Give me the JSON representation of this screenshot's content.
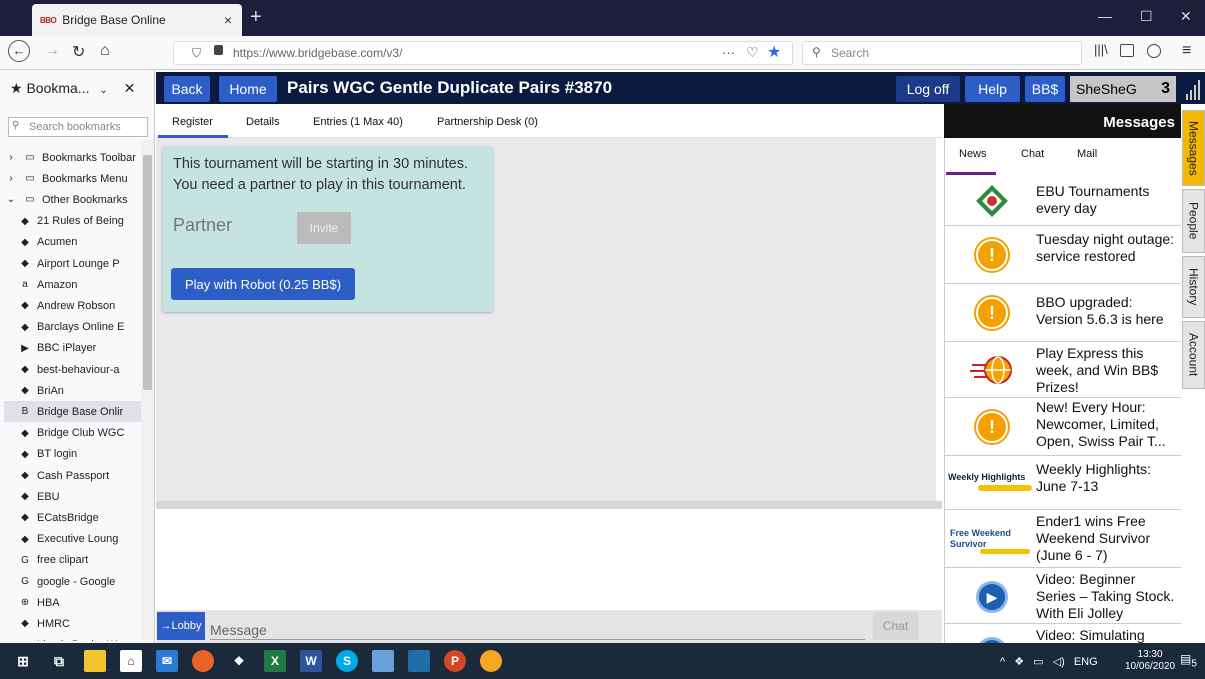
{
  "browser": {
    "tab_title": "Bridge Base Online",
    "tab_favicon_text": "BBO",
    "url": "https://www.bridgebase.com/v3/",
    "search_placeholder": "Search",
    "url_actions": "···"
  },
  "sidebar": {
    "header": "Bookma...",
    "search_placeholder": "Search bookmarks",
    "items": [
      {
        "label": "Bookmarks Toolbar",
        "icon": "folder-icon"
      },
      {
        "label": "Bookmarks Menu",
        "icon": "folder-icon"
      },
      {
        "label": "Other Bookmarks",
        "icon": "folder-icon"
      },
      {
        "label": "21 Rules of Being",
        "icon": "page-icon"
      },
      {
        "label": "Acumen",
        "icon": "page-icon"
      },
      {
        "label": "Airport Lounge P",
        "icon": "page-icon"
      },
      {
        "label": "Amazon",
        "icon": "amazon-icon"
      },
      {
        "label": "Andrew Robson",
        "icon": "page-icon"
      },
      {
        "label": "Barclays Online E",
        "icon": "page-icon"
      },
      {
        "label": "BBC iPlayer",
        "icon": "play-icon"
      },
      {
        "label": "best-behaviour-a",
        "icon": "page-icon"
      },
      {
        "label": "BriAn",
        "icon": "page-icon"
      },
      {
        "label": "Bridge Base Onlir",
        "icon": "bbo-icon"
      },
      {
        "label": "Bridge Club WGC",
        "icon": "page-icon"
      },
      {
        "label": "BT login",
        "icon": "page-icon"
      },
      {
        "label": "Cash Passport",
        "icon": "page-icon"
      },
      {
        "label": "EBU",
        "icon": "page-icon"
      },
      {
        "label": "ECatsBridge",
        "icon": "page-icon"
      },
      {
        "label": "Executive Loung",
        "icon": "page-icon"
      },
      {
        "label": "free clipart",
        "icon": "google-icon"
      },
      {
        "label": "google - Google",
        "icon": "google-icon"
      },
      {
        "label": "HBA",
        "icon": "globe-icon"
      },
      {
        "label": "HMRC",
        "icon": "page-icon"
      },
      {
        "label": "Lloyds Bank - We",
        "icon": "page-icon"
      }
    ]
  },
  "bbo": {
    "back": "Back",
    "home": "Home",
    "title": "Pairs WGC Gentle Duplicate Pairs #3870",
    "logoff": "Log off",
    "help": "Help",
    "bbs": "BB$",
    "username": "SheSheG",
    "user_count": "3",
    "tabs": [
      "Register",
      "Details",
      "Entries (1 Max 40)",
      "Partnership Desk (0)"
    ],
    "notice_line1": "This tournament will be starting in 30 minutes.",
    "notice_line2": "You need a partner to play in this tournament.",
    "partner_label": "Partner",
    "invite": "Invite",
    "robot": "Play with Robot (0.25 BB$)",
    "lobby": "→Lobby",
    "message_placeholder": "Message",
    "chat": "Chat"
  },
  "right_panel": {
    "header": "Messages",
    "tabs": [
      "News",
      "Chat",
      "Mail"
    ],
    "news": [
      {
        "text": "EBU Tournaments every day",
        "icon": "ebu-logo-icon"
      },
      {
        "text": "Tuesday night outage: service restored",
        "icon": "alert-icon"
      },
      {
        "text": "BBO upgraded: Version 5.6.3 is here",
        "icon": "alert-icon"
      },
      {
        "text": "Play Express this week, and Win BB$ Prizes!",
        "icon": "express-globe-icon"
      },
      {
        "text": "New! Every Hour: Newcomer, Limited, Open, Swiss Pair T...",
        "icon": "alert-icon"
      },
      {
        "text": "Weekly Highlights: June 7-13",
        "icon_label": "Weekly Highlights"
      },
      {
        "text": "Ender1 wins Free Weekend Survivor (June 6 - 7)",
        "icon_label": "Free Weekend Survivor"
      },
      {
        "text": "Video: Beginner Series – Taking Stock. With Eli Jolley",
        "icon": "video-icon"
      },
      {
        "text": "Video: Simulating",
        "icon": "video-icon"
      }
    ],
    "side_tabs": [
      "Messages",
      "People",
      "History",
      "Account"
    ]
  },
  "taskbar": {
    "time": "13:30",
    "date": "10/06/2020",
    "lang": "ENG",
    "notif_count": "5"
  }
}
